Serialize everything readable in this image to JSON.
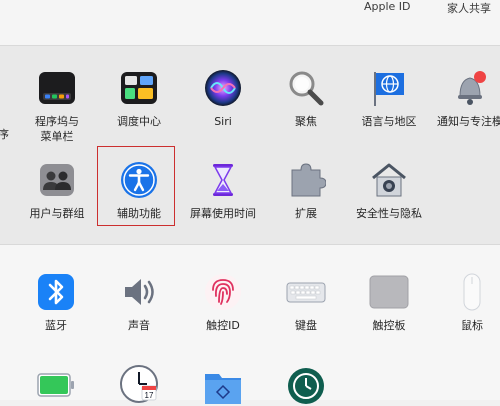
{
  "header": {
    "apple_id": "Apple ID",
    "family": "家人共享"
  },
  "row1": [
    {
      "label": "程序坞与\n菜单栏",
      "icon": "dock-icon"
    },
    {
      "label": "调度中心",
      "icon": "mission-control-icon"
    },
    {
      "label": "Siri",
      "icon": "siri-icon"
    },
    {
      "label": "聚焦",
      "icon": "magnifier-icon"
    },
    {
      "label": "语言与地区",
      "icon": "globe-flag-icon"
    },
    {
      "label": "通知与专注模",
      "icon": "bell-icon"
    }
  ],
  "row1_partial_left": "序",
  "row2": [
    {
      "label": "用户与群组",
      "icon": "users-icon"
    },
    {
      "label": "辅助功能",
      "icon": "accessibility-icon",
      "highlighted": true
    },
    {
      "label": "屏幕使用时间",
      "icon": "hourglass-icon"
    },
    {
      "label": "扩展",
      "icon": "puzzle-icon"
    },
    {
      "label": "安全性与隐私",
      "icon": "lock-house-icon"
    }
  ],
  "row3": [
    {
      "label": "蓝牙",
      "icon": "bluetooth-icon"
    },
    {
      "label": "声音",
      "icon": "speaker-icon"
    },
    {
      "label": "触控ID",
      "icon": "fingerprint-icon"
    },
    {
      "label": "键盘",
      "icon": "keyboard-icon"
    },
    {
      "label": "触控板",
      "icon": "trackpad-icon"
    },
    {
      "label": "鼠标",
      "icon": "mouse-icon"
    }
  ],
  "row4": [
    {
      "icon": "battery-icon"
    },
    {
      "icon": "clock-icon"
    },
    {
      "icon": "sharing-folder-icon"
    },
    {
      "icon": "time-machine-icon"
    }
  ],
  "calendar_day": "17",
  "colors": {
    "highlight": "#cc2f2f",
    "accent_blue": "#1a73e8"
  }
}
